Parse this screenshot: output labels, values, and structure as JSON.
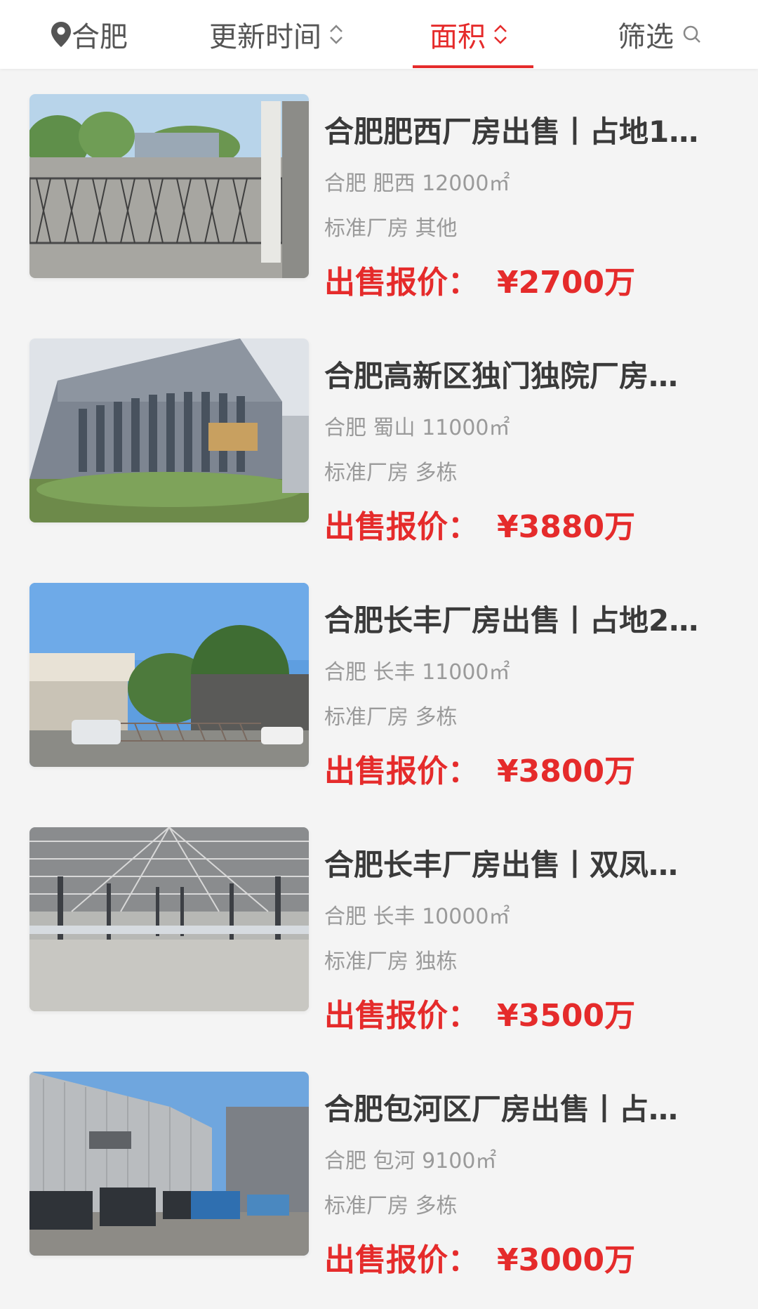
{
  "header": {
    "city": "合肥",
    "sort_update": "更新时间",
    "sort_area": "面积",
    "filter": "筛选",
    "active_color": "#e52b2b"
  },
  "listings": [
    {
      "title": "合肥肥西厂房出售丨占地1…",
      "location": "合肥 肥西 12000㎡",
      "tags": "标准厂房 其他",
      "price_label": "出售报价：",
      "price": "¥2700万"
    },
    {
      "title": "合肥高新区独门独院厂房…",
      "location": "合肥 蜀山 11000㎡",
      "tags": "标准厂房 多栋",
      "price_label": "出售报价：",
      "price": "¥3880万"
    },
    {
      "title": "合肥长丰厂房出售丨占地2…",
      "location": "合肥 长丰 11000㎡",
      "tags": "标准厂房 多栋",
      "price_label": "出售报价：",
      "price": "¥3800万"
    },
    {
      "title": "合肥长丰厂房出售丨双凤…",
      "location": "合肥 长丰 10000㎡",
      "tags": "标准厂房 独栋",
      "price_label": "出售报价：",
      "price": "¥3500万"
    },
    {
      "title": "合肥包河区厂房出售丨占…",
      "location": "合肥 包河 9100㎡",
      "tags": "标准厂房 多栋",
      "price_label": "出售报价：",
      "price": "¥3000万"
    }
  ]
}
